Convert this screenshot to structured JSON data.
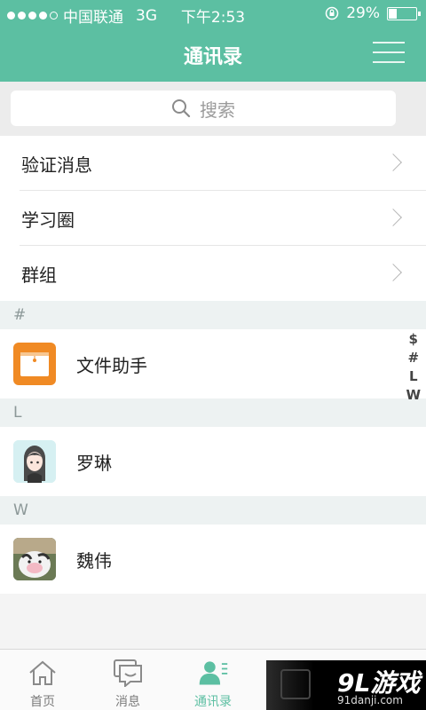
{
  "status_bar": {
    "carrier": "中国联通",
    "network": "3G",
    "time": "下午2:53",
    "battery": "29%",
    "battery_level": 0.29
  },
  "header": {
    "title": "通讯录"
  },
  "search": {
    "placeholder": "搜索"
  },
  "menu": [
    {
      "label": "验证消息"
    },
    {
      "label": "学习圈"
    },
    {
      "label": "群组"
    }
  ],
  "sections": [
    {
      "letter": "#",
      "contacts": [
        {
          "name": "文件助手"
        }
      ]
    },
    {
      "letter": "L",
      "contacts": [
        {
          "name": "罗琳"
        }
      ]
    },
    {
      "letter": "W",
      "contacts": [
        {
          "name": "魏伟"
        }
      ]
    }
  ],
  "alpha_index": [
    "$",
    "#",
    "L",
    "W"
  ],
  "tabs": [
    {
      "label": "首页",
      "icon": "home-icon"
    },
    {
      "label": "消息",
      "icon": "message-icon"
    },
    {
      "label": "通讯录",
      "icon": "contacts-icon",
      "active": true
    }
  ],
  "watermark": {
    "brand": "9L游戏",
    "site": "91danji.com"
  },
  "colors": {
    "accent": "#5cbfa2",
    "file_helper": "#f08a24"
  }
}
